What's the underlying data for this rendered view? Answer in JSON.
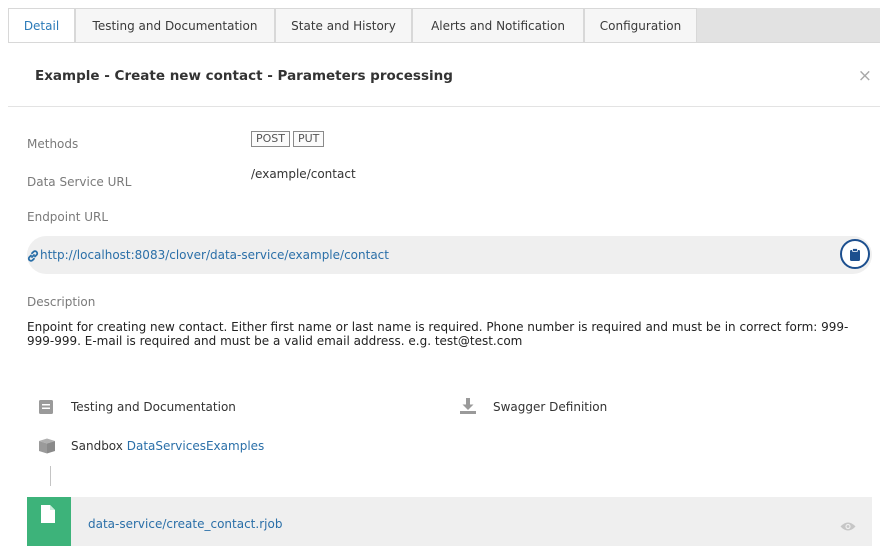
{
  "tabs": [
    {
      "label": "Detail",
      "active": true
    },
    {
      "label": "Testing and Documentation",
      "active": false
    },
    {
      "label": "State and History",
      "active": false
    },
    {
      "label": "Alerts and Notification",
      "active": false
    },
    {
      "label": "Configuration",
      "active": false
    }
  ],
  "header": {
    "title": "Example - Create new contact - Parameters processing",
    "close_glyph": "×"
  },
  "details": {
    "methods_label": "Methods",
    "methods": [
      "POST",
      "PUT"
    ],
    "data_service_url_label": "Data Service URL",
    "data_service_url": "/example/contact",
    "endpoint_url_label": "Endpoint URL",
    "endpoint_url": "http://localhost:8083/clover/data-service/example/contact",
    "description_label": "Description",
    "description": "Enpoint for creating new contact. Either first name or last name is required. Phone number is required and must be in correct form: 999-999-999. E-mail is required and must be a valid email address. e.g. test@test.com"
  },
  "links": {
    "testing_docs": "Testing and Documentation",
    "swagger": "Swagger Definition",
    "sandbox_prefix": "Sandbox",
    "sandbox_name": "DataServicesExamples"
  },
  "job": {
    "path_prefix": "data-service/",
    "path_file": "create_contact.rjob"
  },
  "icons": {
    "link": "link-icon",
    "copy": "clipboard-icon",
    "document": "document-icon",
    "download": "download-icon",
    "sandbox": "box-icon",
    "file": "file-icon",
    "eye": "eye-icon"
  },
  "colors": {
    "accent": "#2a6fa8",
    "copy_button": "#1c4f8e",
    "job_icon_bg": "#3db37a",
    "active_tab_text": "#2a7ab8"
  }
}
